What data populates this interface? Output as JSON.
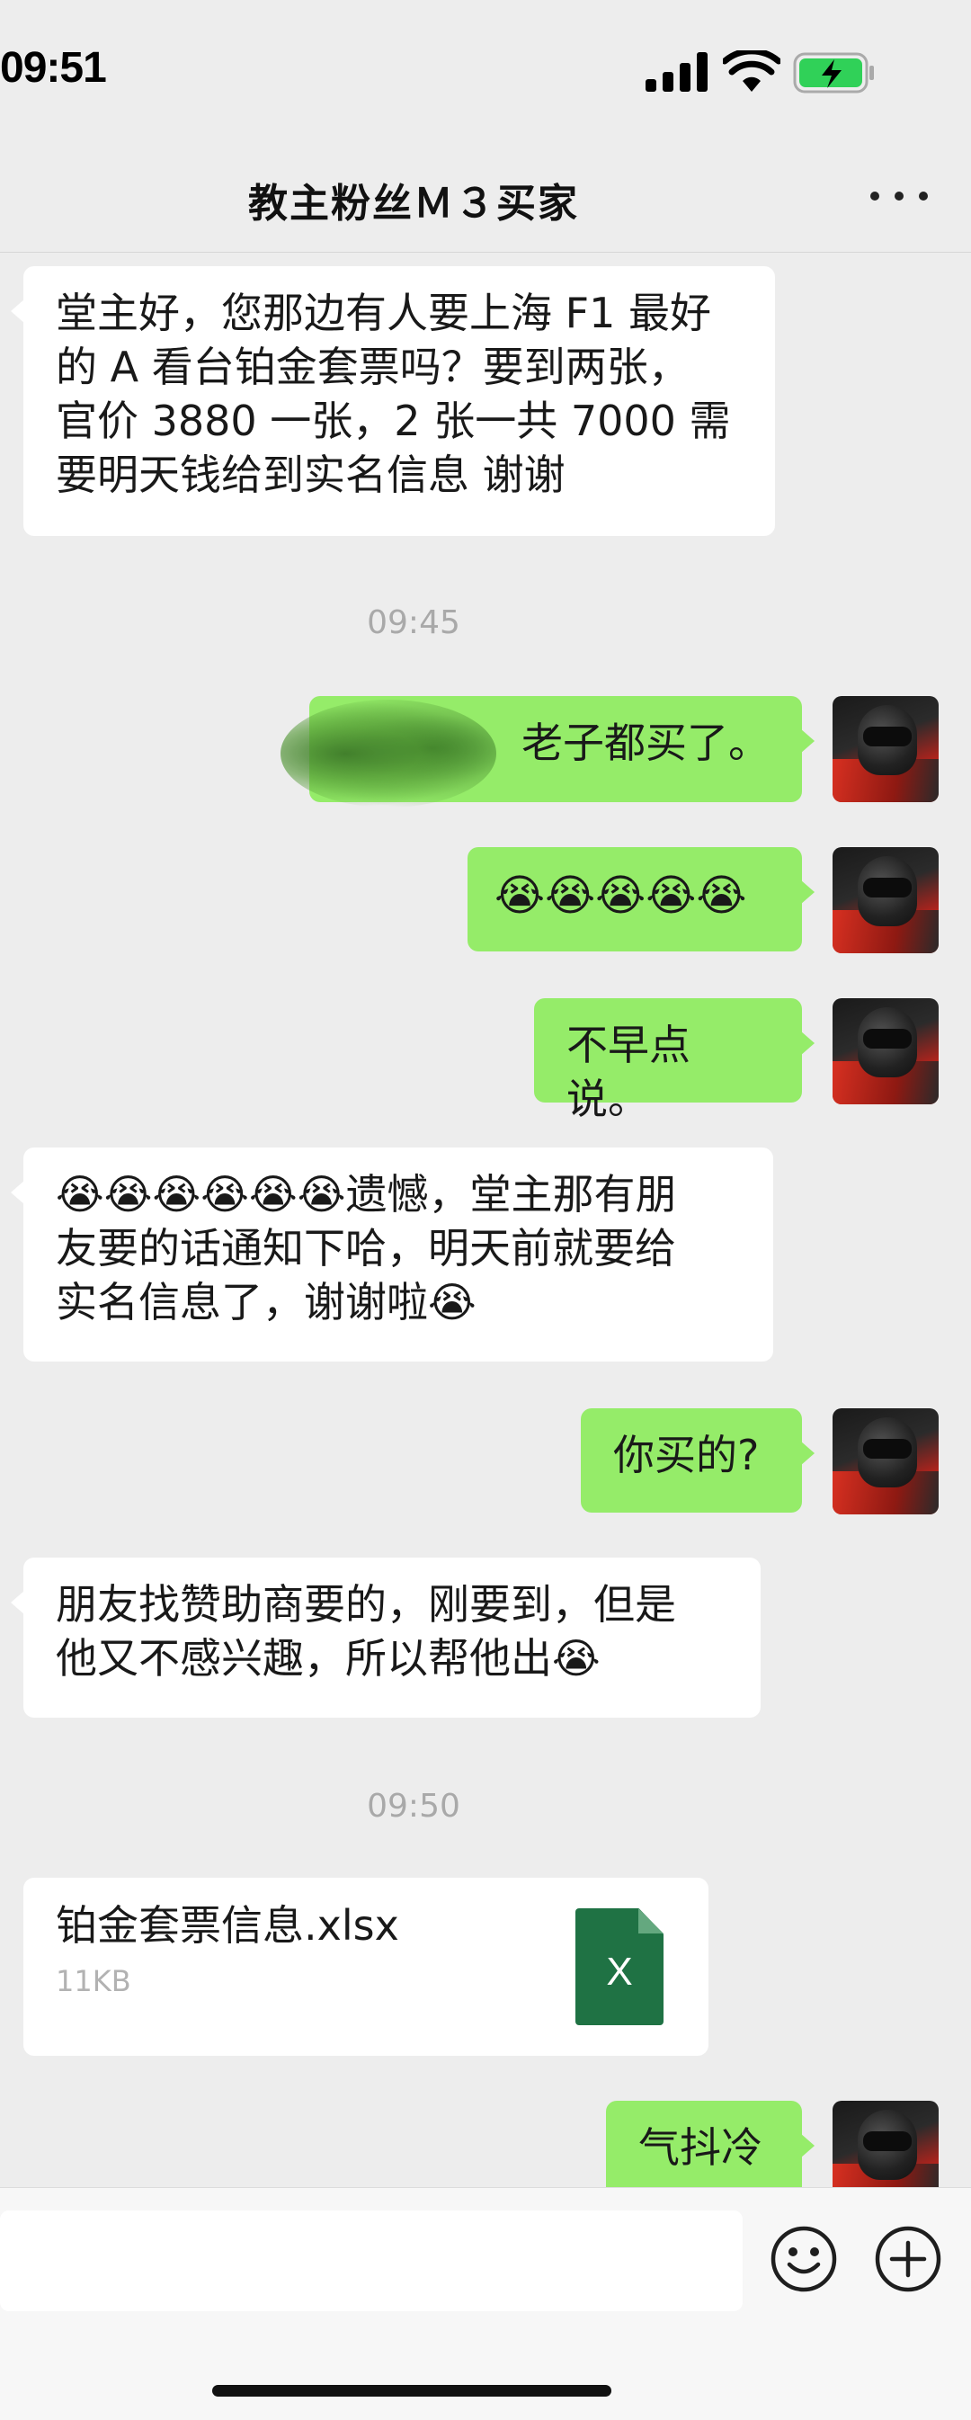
{
  "status_bar": {
    "time": "09:51",
    "battery_color": "#30d158"
  },
  "header": {
    "title": "教主粉丝Ｍ３买家",
    "more_icon": "more-dots-icon"
  },
  "messages": [
    {
      "side": "left",
      "lines": [
        "堂主好，您那边有人要上海 F1 最好",
        "的 A 看台铂金套票吗？要到两张，",
        "官价 3880 一张，2 张一共 7000 需",
        "要明天钱给到实名信息 谢谢"
      ]
    },
    {
      "timestamp": "09:45"
    },
    {
      "side": "right",
      "text": "老子都买了。"
    },
    {
      "side": "right",
      "text": "😭😭😭😭😭"
    },
    {
      "side": "right",
      "text": "不早点说。"
    },
    {
      "side": "left",
      "lines": [
        "😭😭😭😭😭😭遗憾，堂主那有朋",
        "友要的话通知下哈，明天前就要给",
        "实名信息了，谢谢啦😭"
      ]
    },
    {
      "side": "right",
      "text": "你买的?"
    },
    {
      "side": "left",
      "lines": [
        "朋友找赞助商要的，刚要到，但是",
        "他又不感兴趣，所以帮他出😭"
      ]
    },
    {
      "timestamp": "09:50"
    },
    {
      "side": "left",
      "file": {
        "name": "铂金套票信息.xlsx",
        "size": "11KB",
        "icon_letter": "X"
      }
    },
    {
      "side": "right",
      "text": "气抖冷"
    }
  ],
  "input_bar": {
    "emoji_icon": "smiley-icon",
    "plus_icon": "plus-icon"
  },
  "colors": {
    "background": "#ededed",
    "bubble_right": "#95ec69",
    "bubble_left": "#ffffff",
    "excel_green": "#1f7244"
  }
}
